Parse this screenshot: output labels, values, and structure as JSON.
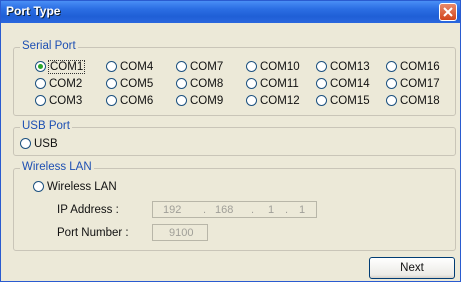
{
  "window": {
    "title": "Port Type"
  },
  "serial": {
    "legend": "Serial Port",
    "options": [
      "COM1",
      "COM4",
      "COM7",
      "COM10",
      "COM13",
      "COM16",
      "COM2",
      "COM5",
      "COM8",
      "COM11",
      "COM14",
      "COM17",
      "COM3",
      "COM6",
      "COM9",
      "COM12",
      "COM15",
      "COM18"
    ],
    "selected": "COM1"
  },
  "usb": {
    "legend": "USB Port",
    "option": "USB"
  },
  "wireless": {
    "legend": "Wireless LAN",
    "option": "Wireless LAN",
    "ip_label": "IP Address :",
    "ip": [
      "192",
      "168",
      "1",
      "1"
    ],
    "port_label": "Port Number :",
    "port": "9100"
  },
  "buttons": {
    "next": "Next"
  },
  "colors": {
    "title_bar": "#2c6fe4",
    "group_legend": "#1d4fb3",
    "selected_dot": "#29a629",
    "close_button": "#d2451c"
  }
}
